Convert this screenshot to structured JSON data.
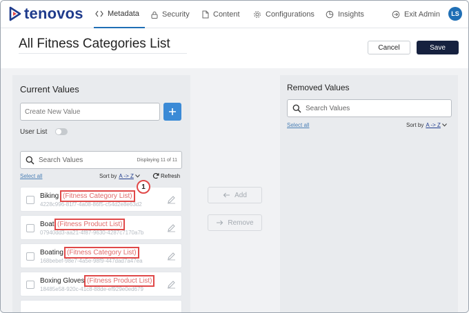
{
  "nav": {
    "brand": "tenovos",
    "items": [
      {
        "label": "Metadata",
        "icon": "code-icon",
        "active": true
      },
      {
        "label": "Security",
        "icon": "lock-icon"
      },
      {
        "label": "Content",
        "icon": "file-icon"
      },
      {
        "label": "Configurations",
        "icon": "gear-icon"
      },
      {
        "label": "Insights",
        "icon": "pie-chart-icon"
      }
    ],
    "exit_label": "Exit Admin",
    "avatar_initials": "LS"
  },
  "header": {
    "title": "All Fitness Categories List",
    "cancel_label": "Cancel",
    "save_label": "Save"
  },
  "current": {
    "title": "Current Values",
    "create_placeholder": "Create New Value",
    "user_list_label": "User List",
    "search_placeholder": "Search Values",
    "displaying": "Displaying 11 of 11",
    "select_all": "Select all",
    "sort_label": "Sort by",
    "sort_value": "A -> Z",
    "refresh_label": "Refresh",
    "callout": "1",
    "items": [
      {
        "name": "Biking",
        "type": "(Fitness Category List)",
        "id": "4228c996-81f7-4a08-86f5-c54d2e8e63d2"
      },
      {
        "name": "Boat",
        "type": "(Fitness Product List)",
        "id": "07940dd3-aa21-4f87-9630-4287c7170a7b"
      },
      {
        "name": "Boating",
        "type": "(Fitness Category List)",
        "id": "168bebef-98e7-4a5e-98f9-447dad7a47ea"
      },
      {
        "name": "Boxing Gloves",
        "type": "(Fitness Product List)",
        "id": "18485e58-920c-41c8-88de-ef929e0ed679"
      }
    ]
  },
  "middle": {
    "add_label": "Add",
    "remove_label": "Remove"
  },
  "removed": {
    "title": "Removed Values",
    "search_placeholder": "Search Values",
    "select_all": "Select all",
    "sort_label": "Sort by",
    "sort_value": "A -> Z"
  },
  "colors": {
    "brand": "#1f3b8c",
    "accent": "#3b8ad6",
    "save_button": "#16213f",
    "highlight": "#e04848"
  }
}
